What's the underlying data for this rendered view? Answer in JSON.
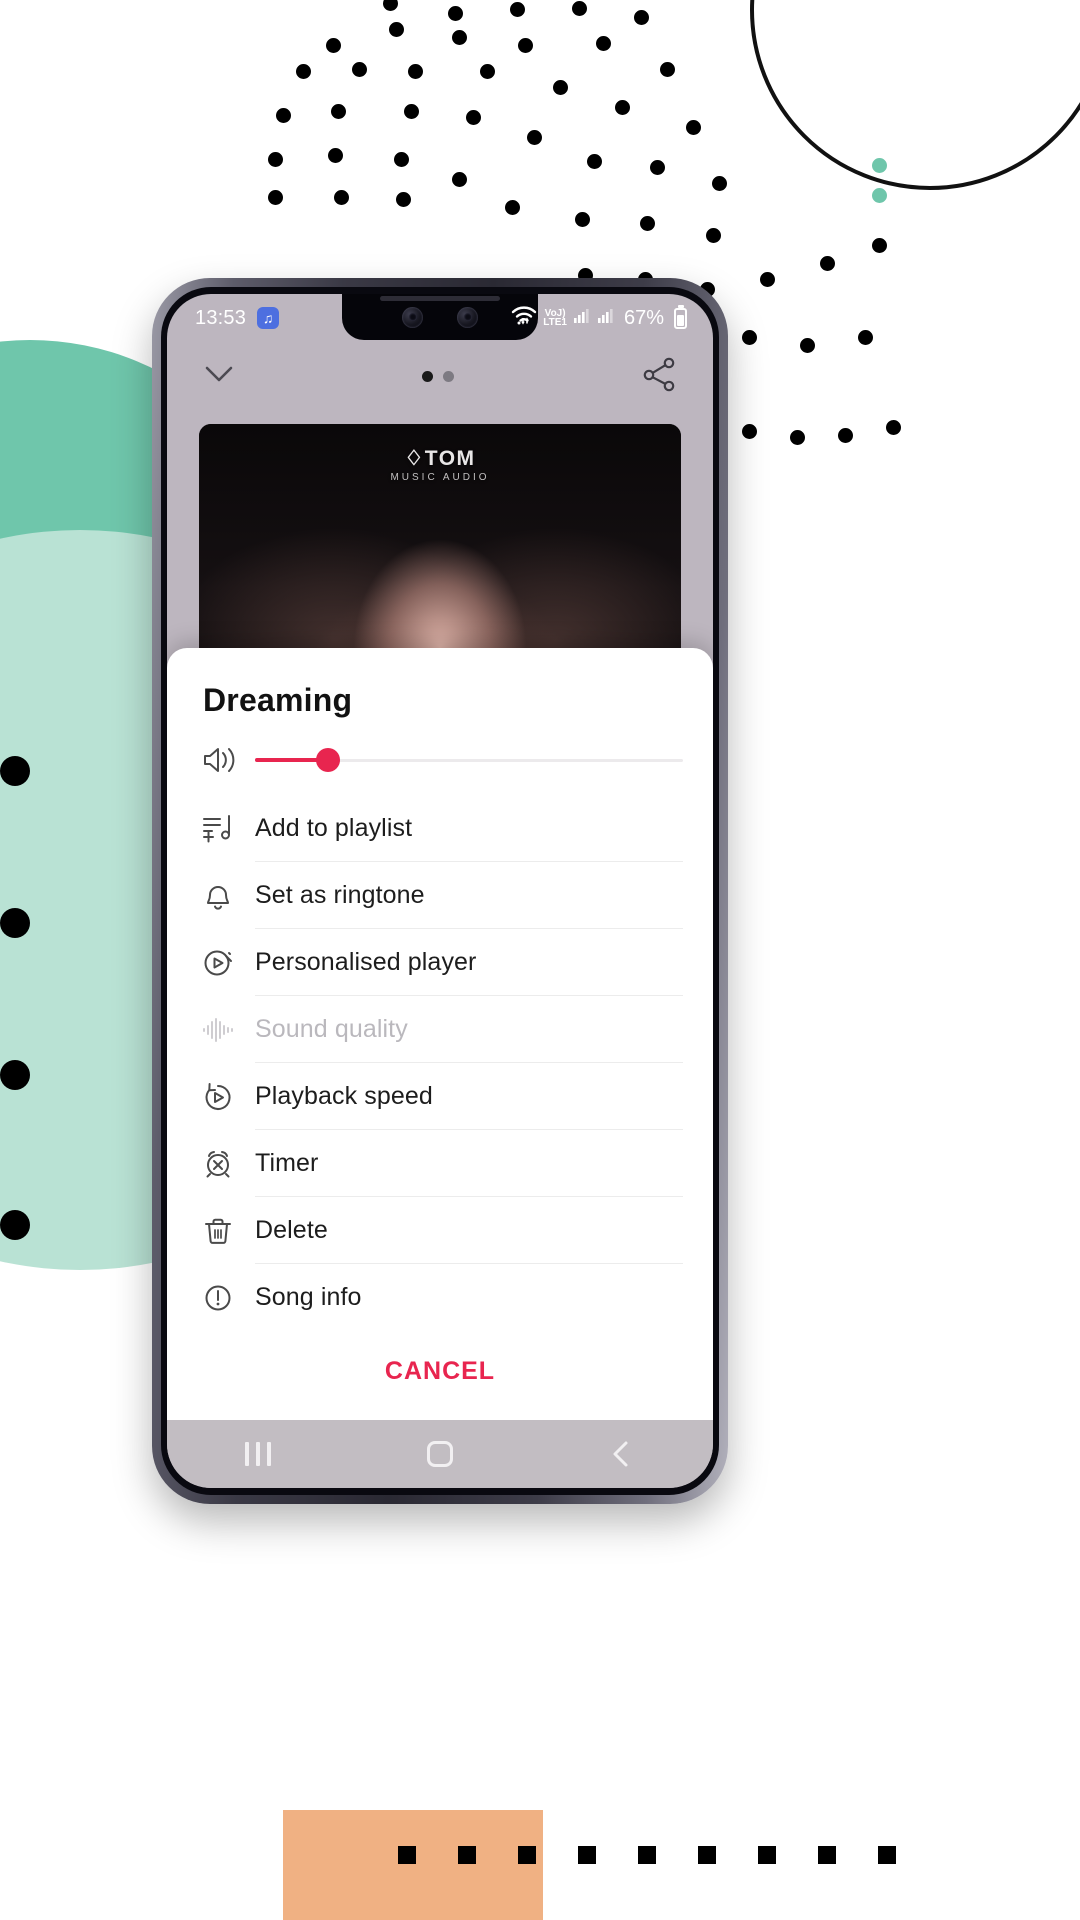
{
  "status_bar": {
    "time": "13:53",
    "music_badge_icon": "music-note-icon",
    "wifi_icon": "wifi-icon",
    "volte_line1": "VoJ)",
    "volte_line2": "LTE1",
    "signal_icon_1": "signal-bars-icon",
    "signal_icon_2": "signal-bars-icon",
    "battery_percent": "67%",
    "battery_icon": "battery-icon"
  },
  "app_header": {
    "collapse_icon": "chevron-down-icon",
    "share_icon": "share-nodes-icon",
    "page_dots": [
      {
        "active": true
      },
      {
        "active": false
      }
    ]
  },
  "album_art": {
    "watermark_line1": "TOM",
    "watermark_line2": "MUSIC AUDIO",
    "drop_icon": "water-drop-icon"
  },
  "sheet": {
    "title": "Dreaming",
    "volume": {
      "icon": "speaker-volume-icon",
      "value_percent": 17,
      "accent_color": "#e8254f",
      "track_color": "#eceaec"
    },
    "menu_items": [
      {
        "id": "add-to-playlist",
        "label": "Add to playlist",
        "icon": "playlist-add-icon",
        "disabled": false
      },
      {
        "id": "set-as-ringtone",
        "label": "Set as ringtone",
        "icon": "bell-icon",
        "disabled": false
      },
      {
        "id": "personalised-player",
        "label": "Personalised player",
        "icon": "play-circle-wand-icon",
        "disabled": false
      },
      {
        "id": "sound-quality",
        "label": "Sound quality",
        "icon": "waveform-icon",
        "disabled": true
      },
      {
        "id": "playback-speed",
        "label": "Playback speed",
        "icon": "speed-play-icon",
        "disabled": false
      },
      {
        "id": "timer",
        "label": "Timer",
        "icon": "alarm-off-icon",
        "disabled": false
      },
      {
        "id": "delete",
        "label": "Delete",
        "icon": "trash-icon",
        "disabled": false
      },
      {
        "id": "song-info",
        "label": "Song info",
        "icon": "info-circle-icon",
        "disabled": false
      }
    ],
    "cancel_label": "CANCEL",
    "cancel_color": "#e8254f"
  },
  "nav_bar": {
    "recents_icon": "recents-icon",
    "home_icon": "home-square-icon",
    "back_icon": "back-chevron-icon"
  },
  "decoration": {
    "blob_dark_color": "#6fc6ab",
    "blob_light_color": "#b9e2d4",
    "dot_color": "#000000",
    "peach_color": "#f0b183"
  }
}
